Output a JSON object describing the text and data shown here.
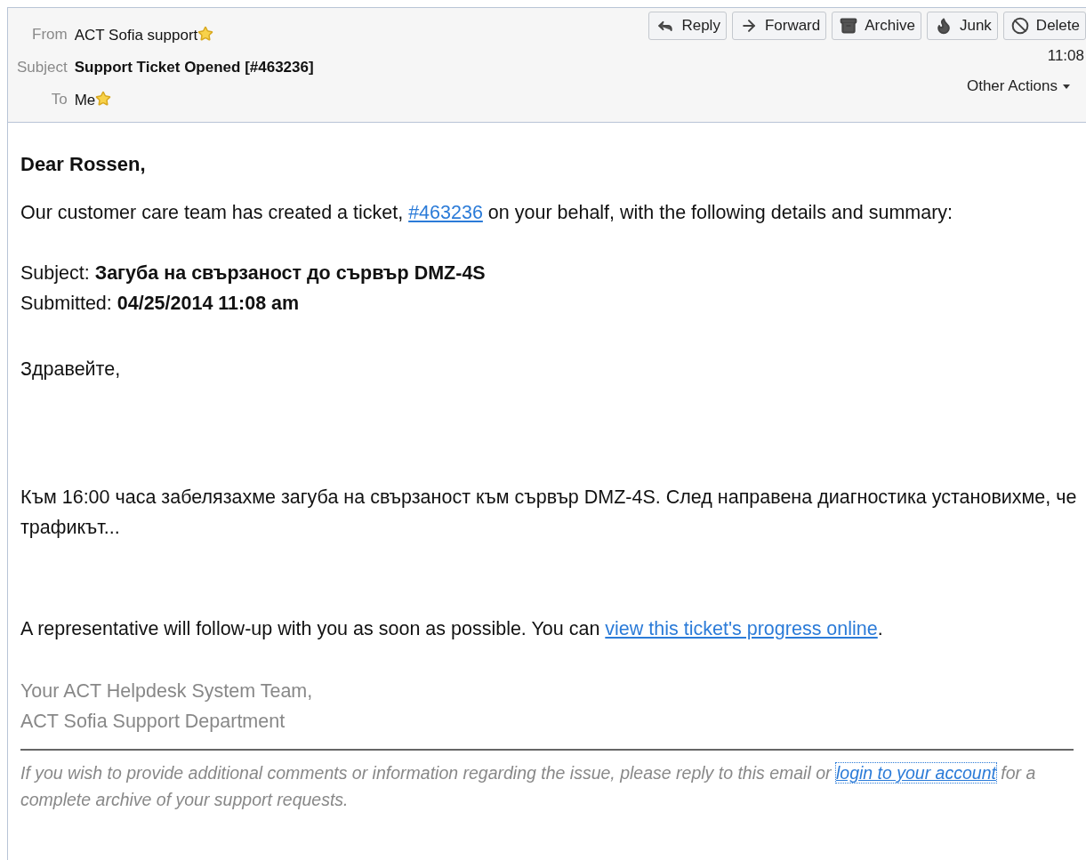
{
  "header": {
    "fields": [
      {
        "kind": "sender",
        "label": "From",
        "value": "ACT Sofia support",
        "starred": true
      },
      {
        "kind": "subject",
        "label": "Subject",
        "value": "Support Ticket Opened [#463236]",
        "starred": false
      },
      {
        "kind": "recipient",
        "label": "To",
        "value": "Me",
        "starred": true
      }
    ],
    "buttons": [
      {
        "label": "Reply"
      },
      {
        "label": "Forward"
      },
      {
        "label": "Archive"
      },
      {
        "label": "Junk"
      },
      {
        "label": "Delete"
      }
    ],
    "time": "11:08",
    "other_actions": "Other Actions"
  },
  "body": [
    {
      "kind": "heading",
      "text": "Dear Rossen,"
    },
    {
      "kind": "paragraph",
      "parts": [
        {
          "text": "Our customer care team has created a ticket, "
        },
        {
          "link": "#463236"
        },
        {
          "text": " on your behalf, with the following details and summary:"
        }
      ]
    },
    {
      "kind": "details",
      "rows": [
        {
          "label": "Subject:",
          "value": "Загуба на свързаност до сървър DMZ-4S"
        },
        {
          "label": "Submitted:",
          "value": "04/25/2014 11:08 am"
        }
      ]
    },
    {
      "kind": "paragraph",
      "parts": [
        {
          "text": "Здравейте,"
        }
      ]
    },
    {
      "kind": "paragraph",
      "parts": [
        {
          "text": "Към 16:00 часа забелязахме загуба на свързаност към сървър DMZ-4S. След направена диагностика установихме, че трафикът..."
        }
      ]
    },
    {
      "kind": "paragraph",
      "parts": [
        {
          "text": "A representative will follow-up with you as soon as possible. You can "
        },
        {
          "link": "view this ticket's progress online"
        },
        {
          "text": "."
        }
      ]
    },
    {
      "kind": "signature",
      "lines": [
        "Your ACT Helpdesk System Team,",
        "ACT Sofia Support Department"
      ]
    }
  ],
  "footer": {
    "parts": [
      {
        "text": "If you wish to provide additional comments or information regarding the issue, please reply to this email or "
      },
      {
        "link": "login to your account"
      },
      {
        "text": " for a complete archive of your support requests."
      }
    ]
  }
}
